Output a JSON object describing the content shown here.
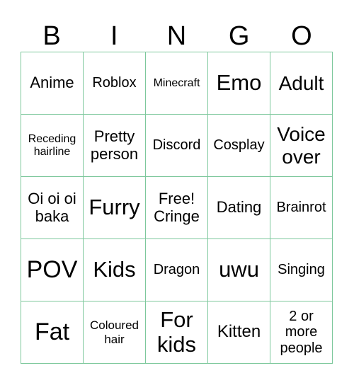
{
  "header": [
    "B",
    "I",
    "N",
    "G",
    "O"
  ],
  "grid_color": "#7dc89c",
  "cells": [
    [
      "Anime",
      "Roblox",
      "Minecraft",
      "Emo",
      "Adult"
    ],
    [
      "Receding hairline",
      "Pretty person",
      "Discord",
      "Cosplay",
      "Voice over"
    ],
    [
      "Oi oi oi baka",
      "Furry",
      "Free! Cringe",
      "Dating",
      "Brainrot"
    ],
    [
      "POV",
      "Kids",
      "Dragon",
      "uwu",
      "Singing"
    ],
    [
      "Fat",
      "Coloured hair",
      "For kids",
      "Kitten",
      "2 or more people"
    ]
  ]
}
